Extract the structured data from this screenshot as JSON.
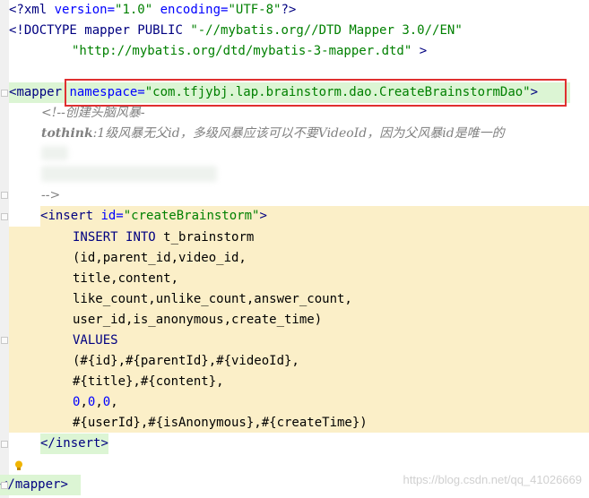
{
  "code": {
    "line1": {
      "open": "<?",
      "name": "xml",
      "a1": " version=",
      "v1": "\"1.0\"",
      "a2": " encoding=",
      "v2": "\"UTF-8\"",
      "close": "?>"
    },
    "line2": {
      "open": "<!",
      "name": "DOCTYPE",
      "text": " mapper PUBLIC ",
      "v": "\"-//mybatis.org//DTD Mapper 3.0//EN\""
    },
    "line3": {
      "v": "\"http://mybatis.org/dtd/mybatis-3-mapper.dtd\"",
      "close": " >"
    },
    "line5": {
      "open": "<",
      "name": "mapper",
      "attr": " namespace=",
      "v": "\"com.tfjybj.lap.brainstorm.dao.CreateBrainstormDao\"",
      "close": ">"
    },
    "line6": {
      "comment": "<!--创建头脑风暴-"
    },
    "line7": {
      "bold": "tothink",
      "text": ":1级风暴无父id，多级风暴应该可以不要VideoId，因为父风暴id是唯一的"
    },
    "line10": {
      "comment": "-->"
    },
    "line11": {
      "open": "<",
      "name": "insert",
      "attr": " id=",
      "v": "\"createBrainstorm\"",
      "close": ">"
    },
    "line12": {
      "k1": "INSERT",
      "k2": "INTO",
      "text": " t_brainstorm"
    },
    "line13": "(id,parent_id,video_id,",
    "line14": "title,content,",
    "line15": "like_count,unlike_count,answer_count,",
    "line16": "user_id,is_anonymous,create_time)",
    "line17": "VALUES",
    "line18": "(#{id},#{parentId},#{videoId},",
    "line19": "#{title},#{content},",
    "line20": {
      "n": "0",
      "sep": ",",
      "n2": "0",
      "sep2": ",",
      "n3": "0",
      "sep3": ","
    },
    "line21": "#{userId},#{isAnonymous},#{createTime})",
    "line22": {
      "open": "</",
      "name": "insert",
      "close": ">"
    },
    "line24": {
      "open": "</",
      "name": "mapper",
      "close": ">"
    }
  },
  "watermark": "https://blog.csdn.net/qq_41026669",
  "colors": {
    "green_bg": "#dcf5d4",
    "yellow_bg": "#fbefc8",
    "highlight": "#e03030"
  },
  "icons": {
    "bulb": "lightbulb-icon"
  }
}
